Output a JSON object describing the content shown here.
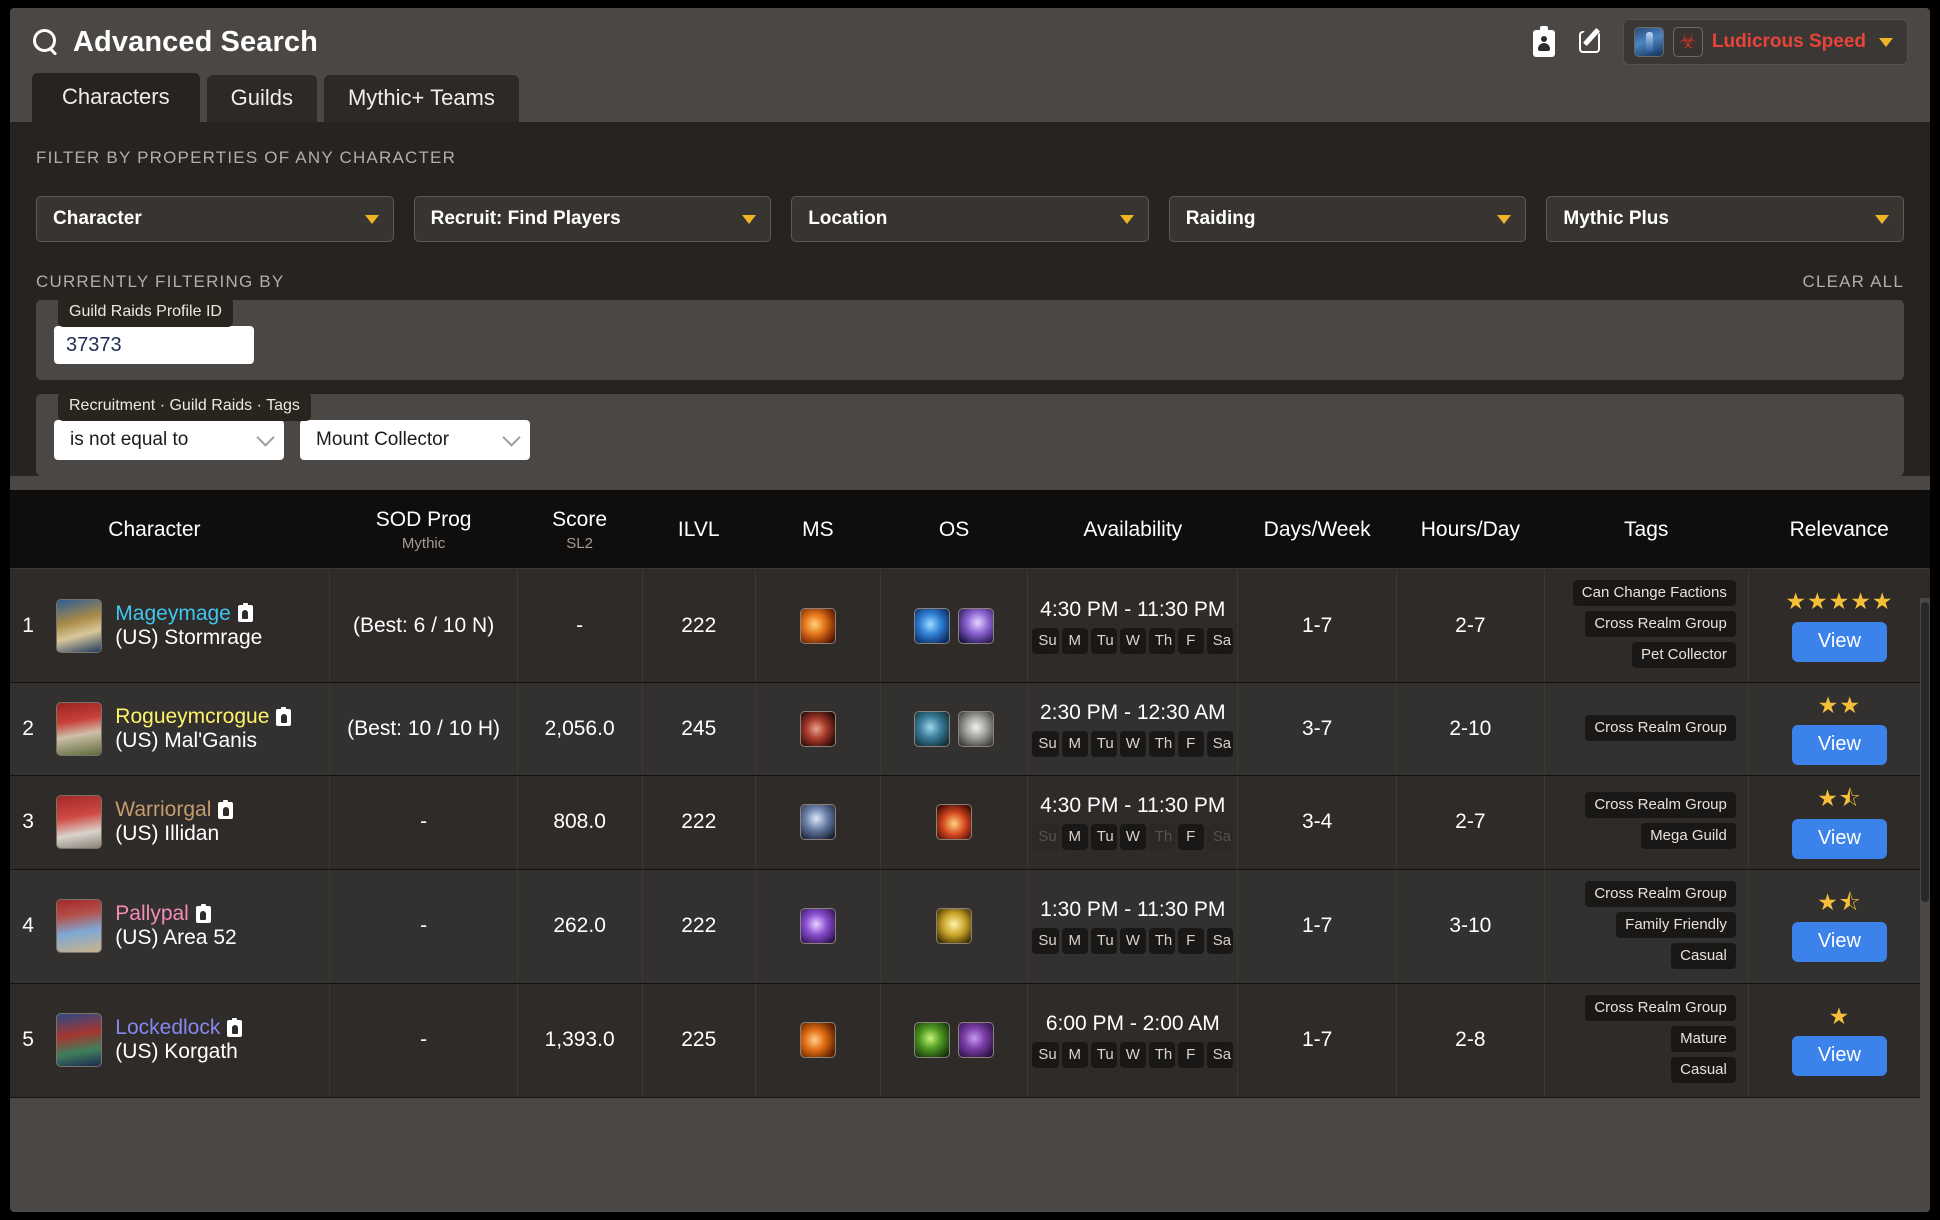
{
  "header": {
    "title": "Advanced Search",
    "search_icon": "search-icon",
    "roster_icon": "roster-clipboard-icon",
    "edit_icon": "edit-compose-icon",
    "user": {
      "name": "Ludicrous Speed",
      "name_color": "#e8443a",
      "faction_icon": "horde-faction-icon",
      "avatar_icon": "guild-avatar-icon",
      "caret": "chevron-down-icon"
    }
  },
  "tabs": [
    {
      "label": "Characters",
      "active": true
    },
    {
      "label": "Guilds",
      "active": false
    },
    {
      "label": "Mythic+ Teams",
      "active": false
    }
  ],
  "filters": {
    "section_label": "FILTER BY PROPERTIES OF ANY CHARACTER",
    "dropdowns": [
      {
        "label": "Character"
      },
      {
        "label": "Recruit: Find Players"
      },
      {
        "label": "Location"
      },
      {
        "label": "Raiding"
      },
      {
        "label": "Mythic Plus"
      }
    ],
    "currently_filtering_label": "CURRENTLY FILTERING BY",
    "clear_all_label": "CLEAR ALL",
    "groups": [
      {
        "tag": "Guild Raids Profile ID",
        "input_value": "37373",
        "input_placeholder": ""
      },
      {
        "tag": "Recruitment · Guild Raids · Tags",
        "operator": "is not equal to",
        "value": "Mount Collector"
      }
    ]
  },
  "table": {
    "columns": [
      {
        "label": "Character",
        "sub": ""
      },
      {
        "label": "SOD Prog",
        "sub": "Mythic"
      },
      {
        "label": "Score",
        "sub": "SL2"
      },
      {
        "label": "ILVL",
        "sub": ""
      },
      {
        "label": "MS",
        "sub": ""
      },
      {
        "label": "OS",
        "sub": ""
      },
      {
        "label": "Availability",
        "sub": ""
      },
      {
        "label": "Days/Week",
        "sub": ""
      },
      {
        "label": "Hours/Day",
        "sub": ""
      },
      {
        "label": "Tags",
        "sub": ""
      },
      {
        "label": "Relevance",
        "sub": ""
      }
    ],
    "day_labels": [
      "Su",
      "M",
      "Tu",
      "W",
      "Th",
      "F",
      "Sa"
    ],
    "view_label": "View",
    "rows": [
      {
        "index": "1",
        "name": "Mageymage",
        "name_color": "#3fc7f0",
        "class_key": "mage",
        "realm": "(US) Stormrage",
        "sod_prog": "(Best: 6 / 10 N)",
        "score": "-",
        "ilvl": "222",
        "ms_specs": [
          "fire"
        ],
        "os_specs": [
          "arcane",
          "frost"
        ],
        "availability": "4:30 PM - 11:30 PM",
        "days_active": [
          true,
          true,
          true,
          true,
          true,
          true,
          true
        ],
        "days_week": "1-7",
        "hours_day": "2-7",
        "tags": [
          "Can Change Factions",
          "Cross Realm Group",
          "Pet Collector"
        ],
        "stars": 5,
        "half_star": false
      },
      {
        "index": "2",
        "name": "Rogueymcrogue",
        "name_color": "#fff468",
        "class_key": "rogue",
        "realm": "(US) Mal'Ganis",
        "sod_prog": "(Best: 10 / 10 H)",
        "score": "2,056.0",
        "ilvl": "245",
        "ms_specs": [
          "assass"
        ],
        "os_specs": [
          "outlaw",
          "sub"
        ],
        "availability": "2:30 PM - 12:30 AM",
        "days_active": [
          true,
          true,
          true,
          true,
          true,
          true,
          true
        ],
        "days_week": "3-7",
        "hours_day": "2-10",
        "tags": [
          "Cross Realm Group"
        ],
        "stars": 2,
        "half_star": false
      },
      {
        "index": "3",
        "name": "Warriorgal",
        "name_color": "#c69b6d",
        "class_key": "warr",
        "realm": "(US) Illidan",
        "sod_prog": "-",
        "score": "808.0",
        "ilvl": "222",
        "ms_specs": [
          "armsw"
        ],
        "os_specs": [
          "prot"
        ],
        "availability": "4:30 PM - 11:30 PM",
        "days_active": [
          false,
          true,
          true,
          true,
          false,
          true,
          false
        ],
        "days_week": "3-4",
        "hours_day": "2-7",
        "tags": [
          "Cross Realm Group",
          "Mega Guild"
        ],
        "stars": 1,
        "half_star": true
      },
      {
        "index": "4",
        "name": "Pallypal",
        "name_color": "#f38cb8",
        "class_key": "pally",
        "realm": "(US) Area 52",
        "sod_prog": "-",
        "score": "262.0",
        "ilvl": "222",
        "ms_specs": [
          "ret"
        ],
        "os_specs": [
          "holy"
        ],
        "availability": "1:30 PM - 11:30 PM",
        "days_active": [
          true,
          true,
          true,
          true,
          true,
          true,
          true
        ],
        "days_week": "1-7",
        "hours_day": "3-10",
        "tags": [
          "Cross Realm Group",
          "Family Friendly",
          "Casual"
        ],
        "stars": 1,
        "half_star": true
      },
      {
        "index": "5",
        "name": "Lockedlock",
        "name_color": "#8787ed",
        "class_key": "lock",
        "realm": "(US) Korgath",
        "sod_prog": "-",
        "score": "1,393.0",
        "ilvl": "225",
        "ms_specs": [
          "destro"
        ],
        "os_specs": [
          "affl",
          "demo"
        ],
        "availability": "6:00 PM - 2:00 AM",
        "days_active": [
          true,
          true,
          true,
          true,
          true,
          true,
          true
        ],
        "days_week": "1-7",
        "hours_day": "2-8",
        "tags": [
          "Cross Realm Group",
          "Mature",
          "Casual"
        ],
        "stars": 1,
        "half_star": false
      }
    ]
  }
}
